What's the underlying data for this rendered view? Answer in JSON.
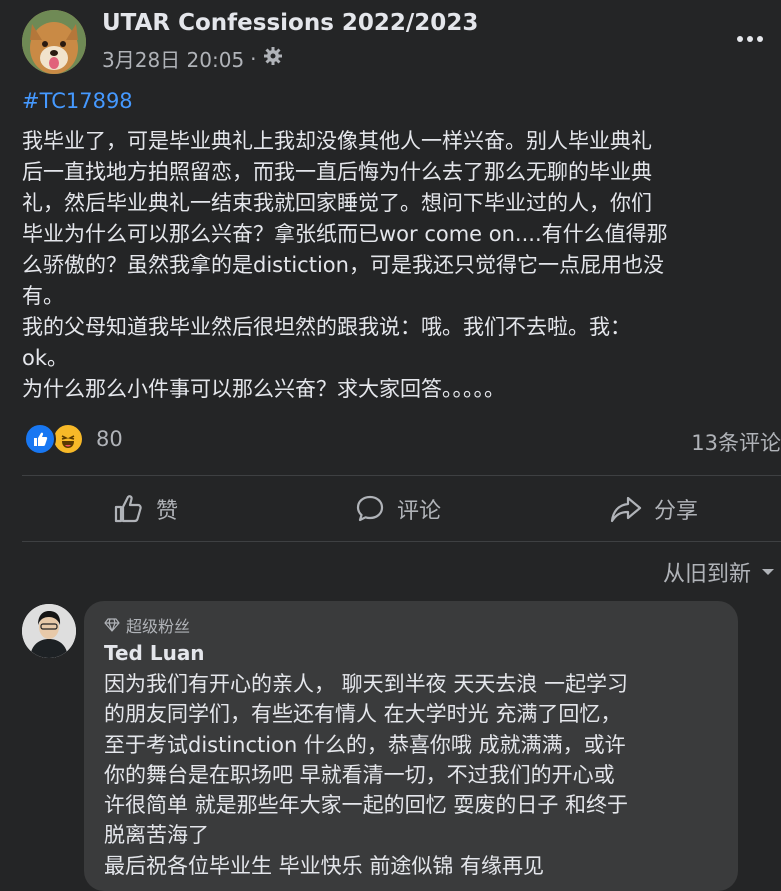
{
  "post": {
    "page_name": "UTAR Confessions 2022/2023",
    "timestamp": "3月28日 20:05",
    "separator": "·",
    "hashtag": "#TC17898",
    "body_lines": [
      "我毕业了，可是毕业典礼上我却没像其他人一样兴奋。别人毕业典礼",
      "后一直找地方拍照留恋，而我一直后悔为什么去了那么无聊的毕业典",
      "礼，然后毕业典礼一结束我就回家睡觉了。想问下毕业过的人，你们",
      "毕业为什么可以那么兴奋？拿张纸而已wor come on....有什么值得那",
      "么骄傲的？虽然我拿的是distiction，可是我还只觉得它一点屁用也没",
      "有。",
      "我的父母知道我毕业然后很坦然的跟我说：哦。我们不去啦。我：",
      "ok。",
      "为什么那么小件事可以那么兴奋？求大家回答。。。。。"
    ],
    "reaction_count": "80",
    "comment_count": "13条评论"
  },
  "actions": {
    "like_label": "赞",
    "comment_label": "评论",
    "share_label": "分享"
  },
  "sort": {
    "label": "从旧到新"
  },
  "comment": {
    "badge": "超级粉丝",
    "author": "Ted Luan",
    "lines": [
      "因为我们有开心的亲人， 聊天到半夜 天天去浪 一起学习",
      "的朋友同学们，有些还有情人 在大学时光 充满了回忆，",
      "至于考试distinction 什么的，恭喜你哦 成就满满，或许",
      "你的舞台是在职场吧 早就看清一切，不过我们的开心或",
      "许很简单 就是那些年大家一起的回忆 耍废的日子 和终于",
      "脱离苦海了",
      "最后祝各位毕业生 毕业快乐 前途似锦 有缘再见"
    ]
  },
  "colors": {
    "background": "#242526",
    "link": "#4599ff",
    "like_blue": "#1877f2",
    "haha_yellow": "#f7b928"
  }
}
